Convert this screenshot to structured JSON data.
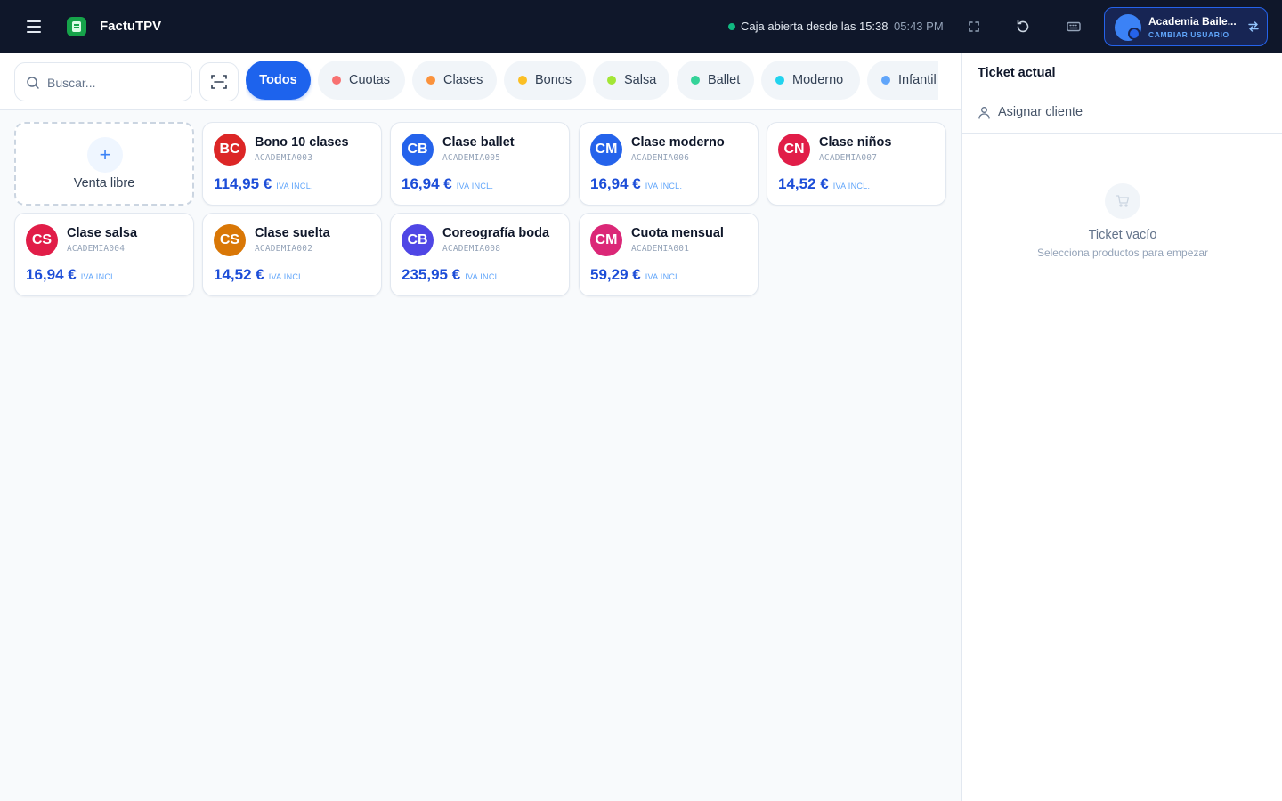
{
  "app": {
    "name": "FactuTPV"
  },
  "header": {
    "caja_status": "Caja abierta desde las 15:38",
    "time": "05:43 PM",
    "user_name": "Academia Baile...",
    "switch_user_label": "CAMBIAR USUARIO"
  },
  "search": {
    "placeholder": "Buscar...",
    "value": ""
  },
  "filters": [
    {
      "label": "Todos",
      "color": ""
    },
    {
      "label": "Cuotas",
      "color": "#f87171"
    },
    {
      "label": "Clases",
      "color": "#fb923c"
    },
    {
      "label": "Bonos",
      "color": "#fbbf24"
    },
    {
      "label": "Salsa",
      "color": "#a3e635"
    },
    {
      "label": "Ballet",
      "color": "#34d399"
    },
    {
      "label": "Moderno",
      "color": "#22d3ee"
    },
    {
      "label": "Infantil",
      "color": "#60a5fa"
    }
  ],
  "free_sale": {
    "label": "Venta libre"
  },
  "products": [
    {
      "initials": "BC",
      "name": "Bono 10 clases",
      "code": "ACADEMIA003",
      "price": "114,95 €",
      "tax_note": "IVA INCL.",
      "color": "#dc2626"
    },
    {
      "initials": "CB",
      "name": "Clase ballet",
      "code": "ACADEMIA005",
      "price": "16,94 €",
      "tax_note": "IVA INCL.",
      "color": "#2563eb"
    },
    {
      "initials": "CM",
      "name": "Clase moderno",
      "code": "ACADEMIA006",
      "price": "16,94 €",
      "tax_note": "IVA INCL.",
      "color": "#2563eb"
    },
    {
      "initials": "CN",
      "name": "Clase niños",
      "code": "ACADEMIA007",
      "price": "14,52 €",
      "tax_note": "IVA INCL.",
      "color": "#e11d48"
    },
    {
      "initials": "CS",
      "name": "Clase salsa",
      "code": "ACADEMIA004",
      "price": "16,94 €",
      "tax_note": "IVA INCL.",
      "color": "#e11d48"
    },
    {
      "initials": "CS",
      "name": "Clase suelta",
      "code": "ACADEMIA002",
      "price": "14,52 €",
      "tax_note": "IVA INCL.",
      "color": "#d97706"
    },
    {
      "initials": "CB",
      "name": "Coreografía boda",
      "code": "ACADEMIA008",
      "price": "235,95 €",
      "tax_note": "IVA INCL.",
      "color": "#4f46e5"
    },
    {
      "initials": "CM",
      "name": "Cuota mensual",
      "code": "ACADEMIA001",
      "price": "59,29 €",
      "tax_note": "IVA INCL.",
      "color": "#db2777"
    }
  ],
  "ticket": {
    "title": "Ticket actual",
    "assign_client": "Asignar cliente",
    "empty_title": "Ticket vacío",
    "empty_subtitle": "Selecciona productos para empezar"
  }
}
